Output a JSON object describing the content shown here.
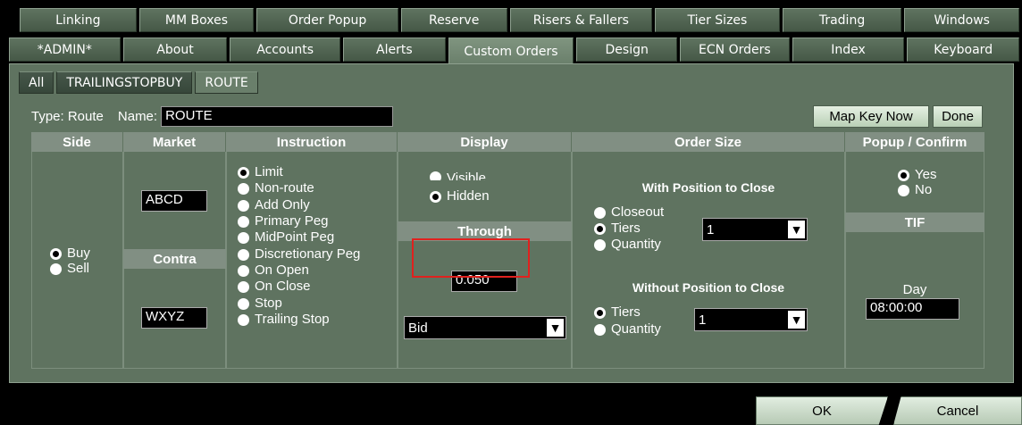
{
  "tabs_row1": [
    "Linking",
    "MM Boxes",
    "Order Popup",
    "Reserve",
    "Risers & Fallers",
    "Tier Sizes",
    "Trading",
    "Windows"
  ],
  "tabs_row2": [
    "*ADMIN*",
    "About",
    "Accounts",
    "Alerts",
    "Custom Orders",
    "Design",
    "ECN Orders",
    "Index",
    "Keyboard"
  ],
  "subtabs": [
    "All",
    "TRAILINGSTOPBUY",
    "ROUTE"
  ],
  "type_label": "Type: Route",
  "name_label": "Name:",
  "name_value": "ROUTE",
  "map_key_now": "Map Key Now",
  "done": "Done",
  "headers": {
    "side": "Side",
    "market": "Market",
    "instruction": "Instruction",
    "display": "Display",
    "order_size": "Order Size",
    "popup_confirm": "Popup / Confirm"
  },
  "side": {
    "buy": "Buy",
    "sell": "Sell",
    "selected": "Buy"
  },
  "market": {
    "value": "ABCD",
    "contra_label": "Contra",
    "contra_value": "WXYZ"
  },
  "instructions": [
    "Limit",
    "Non-route",
    "Add Only",
    "Primary Peg",
    "MidPoint Peg",
    "Discretionary Peg",
    "On Open",
    "On Close",
    "Stop",
    "Trailing Stop"
  ],
  "instruction_selected": "Limit",
  "display": {
    "visible": "Visible",
    "hidden": "Hidden",
    "selected": "Hidden",
    "through_label": "Through",
    "through_value": "0.050",
    "price_select": "Bid"
  },
  "order_size": {
    "with_close_label": "With Position to Close",
    "with_close_options": [
      "Closeout",
      "Tiers",
      "Quantity"
    ],
    "with_close_selected": "Tiers",
    "with_close_value": "1",
    "without_close_label": "Without Position to Close",
    "without_close_options": [
      "Tiers",
      "Quantity"
    ],
    "without_close_selected": "Tiers",
    "without_close_value": "1"
  },
  "popup": {
    "yes": "Yes",
    "no": "No",
    "selected": "Yes",
    "tif_label": "TIF",
    "tif_value": "Day",
    "time_value": "08:00:00"
  },
  "footer": {
    "ok": "OK",
    "cancel": "Cancel"
  }
}
